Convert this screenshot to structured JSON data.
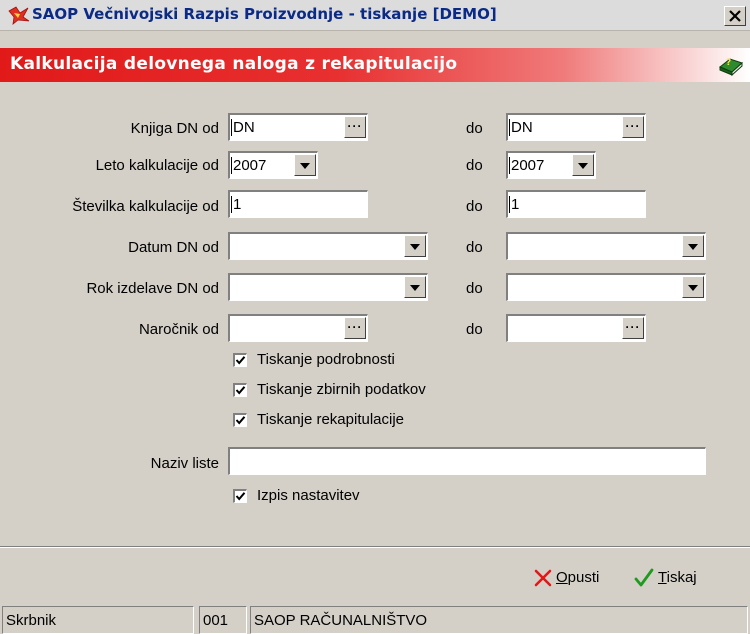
{
  "window": {
    "title": "SAOP  Večnivojski Razpis Proizvodnje - tiskanje [DEMO]",
    "close_label": "x",
    "app_icon": "saop-logo-icon"
  },
  "header": {
    "title": "Kalkulacija delovnega naloga z rekapitulacijo",
    "help_icon": "help-book-icon"
  },
  "form": {
    "do_label": "do",
    "knjiga": {
      "label": "Knjiga DN od",
      "from": "DN",
      "to": "DN"
    },
    "leto": {
      "label": "Leto kalkulacije od",
      "from": "2007",
      "to": "2007"
    },
    "stevilka": {
      "label": "Številka kalkulacije od",
      "from": "1",
      "to": "1"
    },
    "datum": {
      "label": "Datum DN od",
      "from": "",
      "to": ""
    },
    "rok": {
      "label": "Rok izdelave DN od",
      "from": "",
      "to": ""
    },
    "narocnik": {
      "label": "Naročnik od",
      "from": "",
      "to": ""
    },
    "options": {
      "podrobnosti": {
        "label": "Tiskanje podrobnosti",
        "checked": true
      },
      "zbirni": {
        "label": "Tiskanje zbirnih podatkov",
        "checked": true
      },
      "rekapitulacija": {
        "label": "Tiskanje rekapitulacije",
        "checked": true
      }
    },
    "naziv_liste": {
      "label": "Naziv liste",
      "value": ""
    },
    "izpis_nastavitev": {
      "label": "Izpis nastavitev",
      "checked": true
    }
  },
  "actions": {
    "cancel": {
      "underlined": "O",
      "rest": "pusti",
      "icon": "red-x-icon"
    },
    "print": {
      "underlined": "T",
      "rest": "iskaj",
      "icon": "green-check-icon"
    }
  },
  "status": {
    "user": "Skrbnik",
    "code": "001",
    "company": "SAOP RAČUNALNIŠTVO"
  },
  "colors": {
    "header_red": "#e11919",
    "title_blue": "#0a2a86",
    "background": "#d4d0c8"
  }
}
